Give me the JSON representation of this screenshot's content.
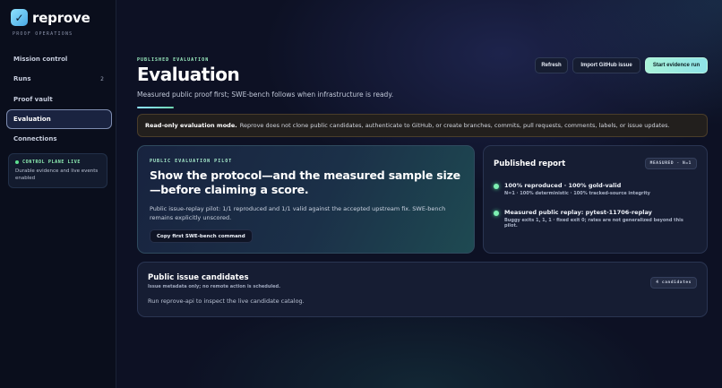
{
  "brand": {
    "name": "reprove",
    "subtitle": "PROOF OPERATIONS",
    "logo_icon": "check-icon"
  },
  "sidebar": {
    "items": [
      {
        "label": "Mission control",
        "count": ""
      },
      {
        "label": "Runs",
        "count": "2"
      },
      {
        "label": "Proof vault",
        "count": ""
      },
      {
        "label": "Evaluation",
        "count": "",
        "active": true
      },
      {
        "label": "Connections",
        "count": ""
      }
    ],
    "control_plane": {
      "title": "CONTROL PLANE LIVE",
      "text": "Durable evidence and live events enabled"
    }
  },
  "header": {
    "eyebrow": "PUBLISHED EVALUATION",
    "title": "Evaluation",
    "subtitle": "Measured public proof first; SWE-bench follows when infrastructure is ready.",
    "buttons": {
      "refresh": "Refresh",
      "import": "Import GitHub issue",
      "start": "Start evidence run"
    }
  },
  "notice": {
    "bold": "Read-only evaluation mode.",
    "text": "Reprove does not clone public candidates, authenticate to GitHub, or create branches, commits, pull requests, comments, labels, or issue updates."
  },
  "pilot": {
    "eyebrow": "PUBLIC EVALUATION PILOT",
    "heading": "Show the protocol—and the measured sample size—before claiming a score.",
    "body": "Public issue-replay pilot: 1/1 reproduced and 1/1 valid against the accepted upstream fix. SWE-bench remains explicitly unscored.",
    "button": "Copy first SWE-bench command"
  },
  "report": {
    "title": "Published report",
    "badge": "MEASURED · N=1",
    "items": [
      {
        "main": "100% reproduced · 100% gold-valid",
        "sub": "N=1 · 100% deterministic · 100% tracked-source integrity"
      },
      {
        "main": "Measured public replay: pytest-11706-replay",
        "sub": "Buggy exits 1, 1, 1 · fixed exit 0; rates are not generalized beyond this pilot."
      }
    ]
  },
  "candidates": {
    "title": "Public issue candidates",
    "meta": "Issue metadata only; no remote action is scheduled.",
    "badge": "4 candidates",
    "body": "Run reprove-api to inspect the live candidate catalog."
  },
  "colors": {
    "accent": "#8fe3ff",
    "success": "#5ee08f",
    "background": "#0d1124"
  }
}
